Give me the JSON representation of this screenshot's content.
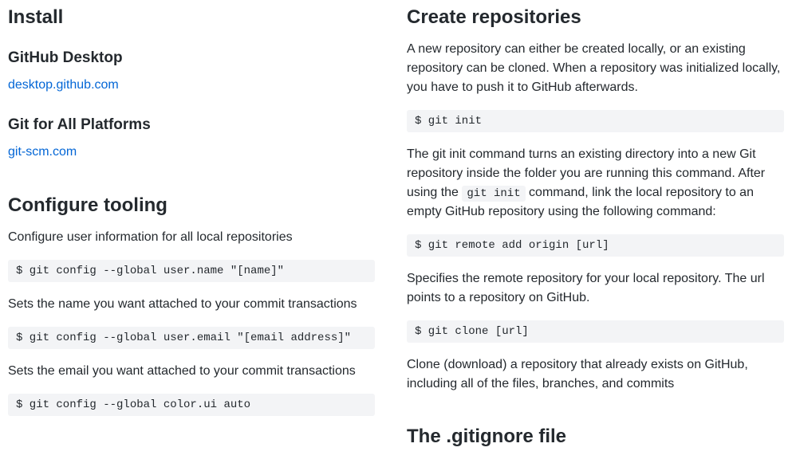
{
  "left": {
    "install_heading": "Install",
    "gh_desktop_heading": "GitHub Desktop",
    "gh_desktop_link": "desktop.github.com",
    "git_all_heading": "Git for All Platforms",
    "git_all_link": "git-scm.com",
    "configure_heading": "Configure tooling",
    "configure_intro": "Configure user information for all local repositories",
    "cmd_name": "$ git config --global user.name \"[name]\"",
    "desc_name": "Sets the name you want attached to your commit transactions",
    "cmd_email": "$ git config --global user.email \"[email address]\"",
    "desc_email": "Sets the email you want attached to your commit transactions",
    "cmd_color": "$ git config --global color.ui auto"
  },
  "right": {
    "create_heading": "Create repositories",
    "create_intro": "A new repository can either be created locally, or an existing repository can be cloned. When a repository was initialized locally, you have to push it to GitHub afterwards.",
    "cmd_init": "$ git init",
    "init_desc_pre": "The git init command turns an existing directory into a new Git repository inside the folder you are running this command. After using the ",
    "init_code": "git init",
    "init_desc_post": " command, link the local repository to an empty GitHub repository using the following command:",
    "cmd_remote": "$ git remote add origin [url]",
    "remote_desc": "Specifies the remote repository for your local repository. The url points to a repository on GitHub.",
    "cmd_clone": "$ git clone [url]",
    "clone_desc": "Clone (download) a repository that already exists on GitHub, including all of the files, branches, and commits",
    "gitignore_heading": "The .gitignore file"
  }
}
